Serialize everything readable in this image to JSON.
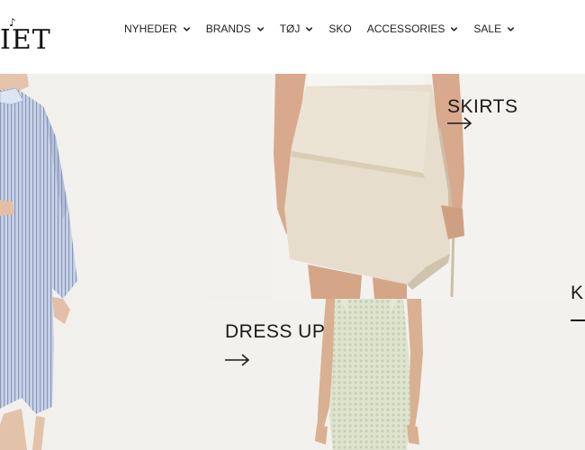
{
  "brand": {
    "logo_text": "IET",
    "flourish": "♪"
  },
  "nav": {
    "items": [
      {
        "label": "NYHEDER",
        "has_dropdown": true
      },
      {
        "label": "BRANDS",
        "has_dropdown": true
      },
      {
        "label": "TØJ",
        "has_dropdown": true
      },
      {
        "label": "SKO",
        "has_dropdown": false
      },
      {
        "label": "ACCESSORIES",
        "has_dropdown": true
      },
      {
        "label": "SALE",
        "has_dropdown": true
      }
    ],
    "dropdown_icon": "chevron-down-icon"
  },
  "hero": {
    "skirts": {
      "title": "SKIRTS",
      "arrow_icon": "arrow-right-icon"
    },
    "dress_up": {
      "title": "DRESS UP",
      "arrow_icon": "arrow-right-icon"
    },
    "partial": {
      "title": "K"
    }
  },
  "colors": {
    "background": "#ffffff",
    "hero_background": "#f1f0ed",
    "text": "#1a1a1a"
  }
}
